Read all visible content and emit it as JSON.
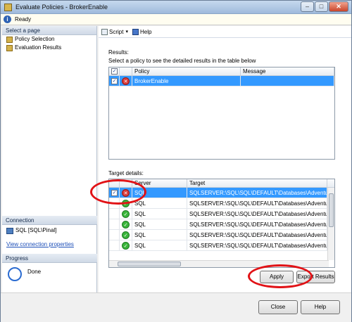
{
  "window": {
    "title": "Evaluate Policies - BrokerEnable"
  },
  "status": {
    "text": "Ready"
  },
  "left": {
    "select_page_header": "Select a page",
    "pages": [
      "Policy Selection",
      "Evaluation Results"
    ],
    "connection_header": "Connection",
    "connection_value": "SQL [SQL\\Pinal]",
    "view_connection_link": "View connection properties",
    "progress_header": "Progress",
    "progress_status": "Done"
  },
  "toolbar": {
    "script_label": "Script",
    "help_label": "Help"
  },
  "results": {
    "label": "Results:",
    "instruction": "Select a policy to see the detailed results in the table below",
    "columns": [
      "Policy",
      "Message"
    ],
    "rows": [
      {
        "policy": "BrokerEnable",
        "message": ""
      }
    ]
  },
  "target": {
    "label": "Target details:",
    "columns": [
      "Server",
      "Target"
    ],
    "rows": [
      {
        "server": "SQL",
        "target": "SQLSERVER:\\SQL\\SQL\\DEFAULT\\Databases\\AdventureW",
        "status": "error"
      },
      {
        "server": "SQL",
        "target": "SQLSERVER:\\SQL\\SQL\\DEFAULT\\Databases\\AdventureW",
        "status": "ok"
      },
      {
        "server": "SQL",
        "target": "SQLSERVER:\\SQL\\SQL\\DEFAULT\\Databases\\AdventureW",
        "status": "ok"
      },
      {
        "server": "SQL",
        "target": "SQLSERVER:\\SQL\\SQL\\DEFAULT\\Databases\\AdventureW",
        "status": "ok"
      },
      {
        "server": "SQL",
        "target": "SQLSERVER:\\SQL\\SQL\\DEFAULT\\Databases\\AdventureW",
        "status": "ok"
      },
      {
        "server": "SQL",
        "target": "SQLSERVER:\\SQL\\SQL\\DEFAULT\\Databases\\AdventureW",
        "status": "ok"
      }
    ]
  },
  "buttons": {
    "apply": "Apply",
    "export": "Export Results",
    "close": "Close",
    "help": "Help"
  },
  "colors": {
    "selected": "#3399ff",
    "annotation": "#e11216"
  }
}
